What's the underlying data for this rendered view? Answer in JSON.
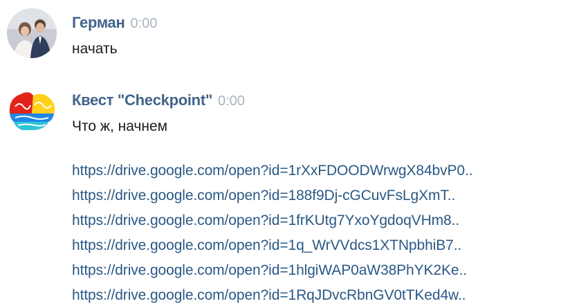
{
  "messages": [
    {
      "author": "Герман",
      "time": "0:00",
      "text": "начать",
      "avatar_icon": "couple-photo-avatar"
    },
    {
      "author": "Квест \"Checkpoint\"",
      "time": "0:00",
      "text": "Что ж, начнем",
      "avatar_icon": "colorful-brain-logo",
      "links": [
        "https://drive.google.com/open?id=1rXxFDOODWrwgX84bvP0..",
        "https://drive.google.com/open?id=188f9Dj-cGCuvFsLgXmT..",
        "https://drive.google.com/open?id=1frKUtg7YxoYgdoqVHm8..",
        "https://drive.google.com/open?id=1q_WrVVdcs1XTNpbhiB7..",
        "https://drive.google.com/open?id=1hlgiWAP0aW38PhYK2Ke..",
        "https://drive.google.com/open?id=1RqJDvcRbnGV0tTKed4w.."
      ]
    }
  ],
  "colors": {
    "author": "#42648b",
    "time": "#a8b4c1",
    "text": "#1b1b1b",
    "link": "#2a5885"
  }
}
